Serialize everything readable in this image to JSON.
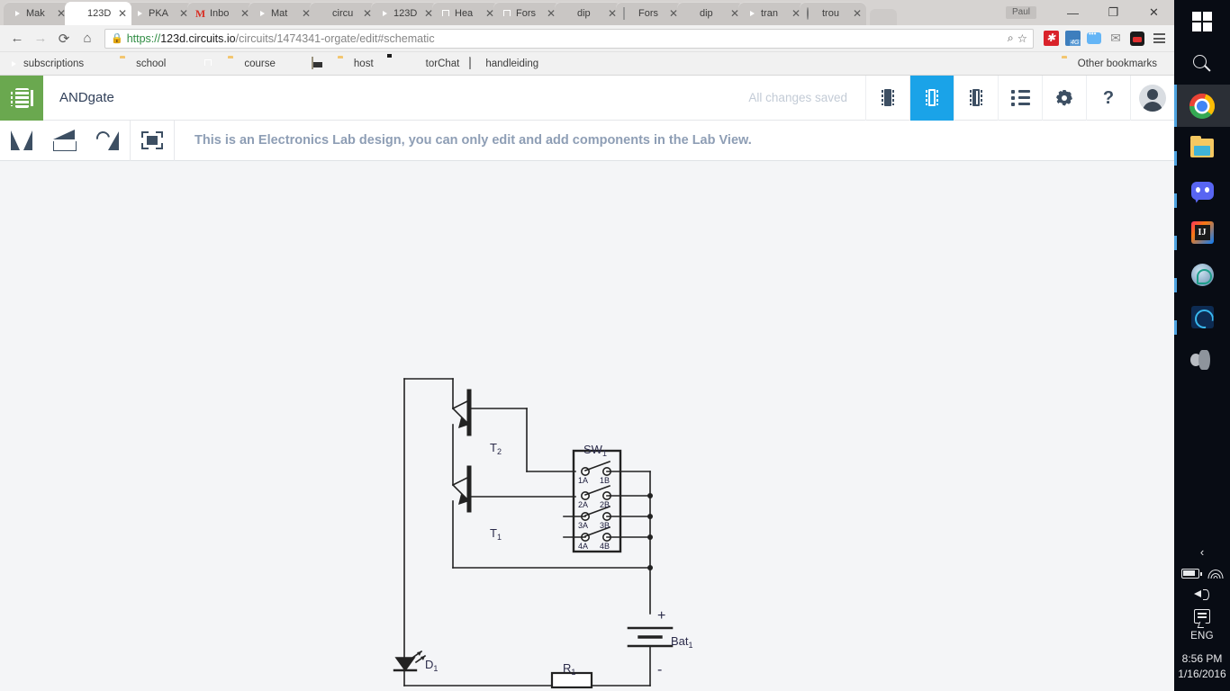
{
  "browser": {
    "tabs": [
      {
        "title": "Mak",
        "icon": "youtube-favicon",
        "active": false
      },
      {
        "title": "123D",
        "icon": "circuits-favicon",
        "active": true
      },
      {
        "title": "PKA",
        "icon": "youtube-favicon",
        "active": false
      },
      {
        "title": "Inbo",
        "icon": "gmail-favicon",
        "active": false
      },
      {
        "title": "Mat",
        "icon": "youtube-favicon",
        "active": false
      },
      {
        "title": "circu",
        "icon": "google-favicon",
        "active": false
      },
      {
        "title": "123D",
        "icon": "youtube-favicon",
        "active": false
      },
      {
        "title": "Hea",
        "icon": "twitch-favicon",
        "active": false
      },
      {
        "title": "Fors",
        "icon": "twitch-favicon",
        "active": false
      },
      {
        "title": "dip",
        "icon": "google-favicon",
        "active": false
      },
      {
        "title": "Fors",
        "icon": "doc-favicon",
        "active": false
      },
      {
        "title": "dip",
        "icon": "google-favicon",
        "active": false
      },
      {
        "title": "tran",
        "icon": "youtube-favicon",
        "active": false
      },
      {
        "title": "trou",
        "icon": "circle-favicon",
        "active": false
      }
    ],
    "tab_close_label": "✕",
    "window": {
      "user": "Paul",
      "minimize": "—",
      "maximize": "❐",
      "close": "✕"
    },
    "nav": {
      "back": "←",
      "forward": "→",
      "reload": "⟳",
      "home": "⌂"
    },
    "omnibox": {
      "lock": "🔒",
      "scheme": "https://",
      "host": "123d.circuits.io",
      "path": "/circuits/1474341-orgate/edit#schematic",
      "full_url": "https://123d.circuits.io/circuits/1474341-orgate/edit#schematic",
      "search_icon": "page-search-icon",
      "star_icon": "☆"
    },
    "bookmarks": [
      {
        "label": "subscriptions",
        "icon": "youtube-icon"
      },
      {
        "label": "",
        "icon": "shield-icon"
      },
      {
        "label": "school",
        "icon": "folder-icon"
      },
      {
        "label": "",
        "icon": "google-drive-icon"
      },
      {
        "label": "",
        "icon": "twitch-icon"
      },
      {
        "label": "course",
        "icon": "folder-icon"
      },
      {
        "label": "",
        "icon": "intellij-icon"
      },
      {
        "label": "",
        "icon": "app-icon"
      },
      {
        "label": "host",
        "icon": "folder-icon"
      },
      {
        "label": "",
        "icon": "github-icon"
      },
      {
        "label": "torChat",
        "icon": "books-icon"
      },
      {
        "label": "handleiding",
        "icon": "document-icon"
      }
    ],
    "other_bookmarks": "Other bookmarks"
  },
  "app": {
    "title": "ANDgate",
    "status": "All changes saved",
    "logo_icon": "chip-logo-icon",
    "header_icons": [
      {
        "name": "breadboard-view-icon",
        "active": false
      },
      {
        "name": "schematic-view-icon",
        "active": true
      },
      {
        "name": "pcb-view-icon",
        "active": false
      },
      {
        "name": "components-list-icon",
        "active": false
      },
      {
        "name": "settings-gear-icon",
        "active": false
      },
      {
        "name": "help-icon",
        "active": false
      },
      {
        "name": "user-avatar",
        "active": false
      }
    ],
    "help_label": "?",
    "toolbar": [
      {
        "name": "flip-vertical-button"
      },
      {
        "name": "flip-horizontal-button"
      },
      {
        "name": "rotate-button"
      },
      {
        "name": "fit-to-screen-button"
      }
    ],
    "notice": "This is an Electronics Lab design, you can only edit and add components in the Lab View.",
    "colors": {
      "accent": "#1aa3e8",
      "logo_green": "#6aa84f",
      "canvas_bg": "#f4f5f7",
      "notice_text": "#8e9eb5",
      "wire": "#222222",
      "label": "#2b2b4a"
    }
  },
  "schematic": {
    "components": [
      {
        "id": "T2",
        "label": "T",
        "sub": "2",
        "type": "npn-transistor"
      },
      {
        "id": "T1",
        "label": "T",
        "sub": "1",
        "type": "npn-transistor"
      },
      {
        "id": "SW1",
        "label": "SW",
        "sub": "1",
        "type": "dip-switch-4pole",
        "pins": [
          "1A",
          "1B",
          "2A",
          "2B",
          "3A",
          "3B",
          "4A",
          "4B"
        ]
      },
      {
        "id": "Bat1",
        "label": "Bat",
        "sub": "1",
        "type": "battery",
        "terminals": {
          "positive": "+",
          "negative": "-"
        }
      },
      {
        "id": "R1",
        "label": "R",
        "sub": "1",
        "type": "resistor"
      },
      {
        "id": "D1",
        "label": "D",
        "sub": "1",
        "type": "led"
      }
    ]
  },
  "taskbar": {
    "items": [
      {
        "name": "start-button",
        "icon": "windows-logo-icon"
      },
      {
        "name": "search-button",
        "icon": "search-icon"
      },
      {
        "name": "taskbar-chrome",
        "icon": "chrome-icon",
        "active": true
      },
      {
        "name": "taskbar-file-explorer",
        "icon": "file-explorer-icon",
        "open": true
      },
      {
        "name": "taskbar-discord",
        "icon": "discord-icon",
        "open": true
      },
      {
        "name": "taskbar-intellij",
        "icon": "intellij-icon",
        "open": true
      },
      {
        "name": "taskbar-app-brain",
        "icon": "brain-app-icon",
        "open": true
      },
      {
        "name": "taskbar-app-blue",
        "icon": "blue-app-icon",
        "open": true
      },
      {
        "name": "taskbar-speaker-app",
        "icon": "speaker-app-icon",
        "open": false
      }
    ],
    "tray": {
      "expand": "‹",
      "battery_icon": "battery-charging-icon",
      "wifi_icon": "wifi-icon",
      "volume_icon": "volume-icon",
      "notifications_icon": "notifications-icon",
      "language": "ENG",
      "time": "8:56 PM",
      "date": "1/16/2016"
    }
  }
}
